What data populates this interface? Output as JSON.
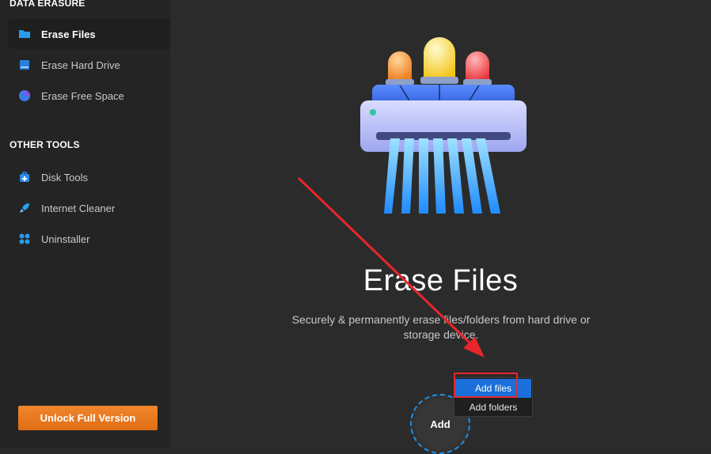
{
  "sidebar": {
    "data_erasure_title": "DATA ERASURE",
    "other_tools_title": "OTHER TOOLS",
    "items": [
      {
        "label": "Erase Files",
        "icon": "folder-icon",
        "active": true
      },
      {
        "label": "Erase Hard Drive",
        "icon": "hard-drive-icon"
      },
      {
        "label": "Erase Free Space",
        "icon": "pie-chart-icon"
      }
    ],
    "tools": [
      {
        "label": "Disk Tools",
        "icon": "toolbox-icon"
      },
      {
        "label": "Internet Cleaner",
        "icon": "rocket-icon"
      },
      {
        "label": "Uninstaller",
        "icon": "apps-grid-icon"
      }
    ],
    "unlock_label": "Unlock Full Version"
  },
  "main": {
    "title": "Erase Files",
    "subtitle": "Securely & permanently erase files/folders from hard drive or storage device.",
    "add_label": "Add",
    "menu": [
      "Add files",
      "Add folders"
    ]
  },
  "colors": {
    "accent": "#1a6fd8",
    "orange": "#e8792a",
    "annotation_red": "#e8262a"
  }
}
